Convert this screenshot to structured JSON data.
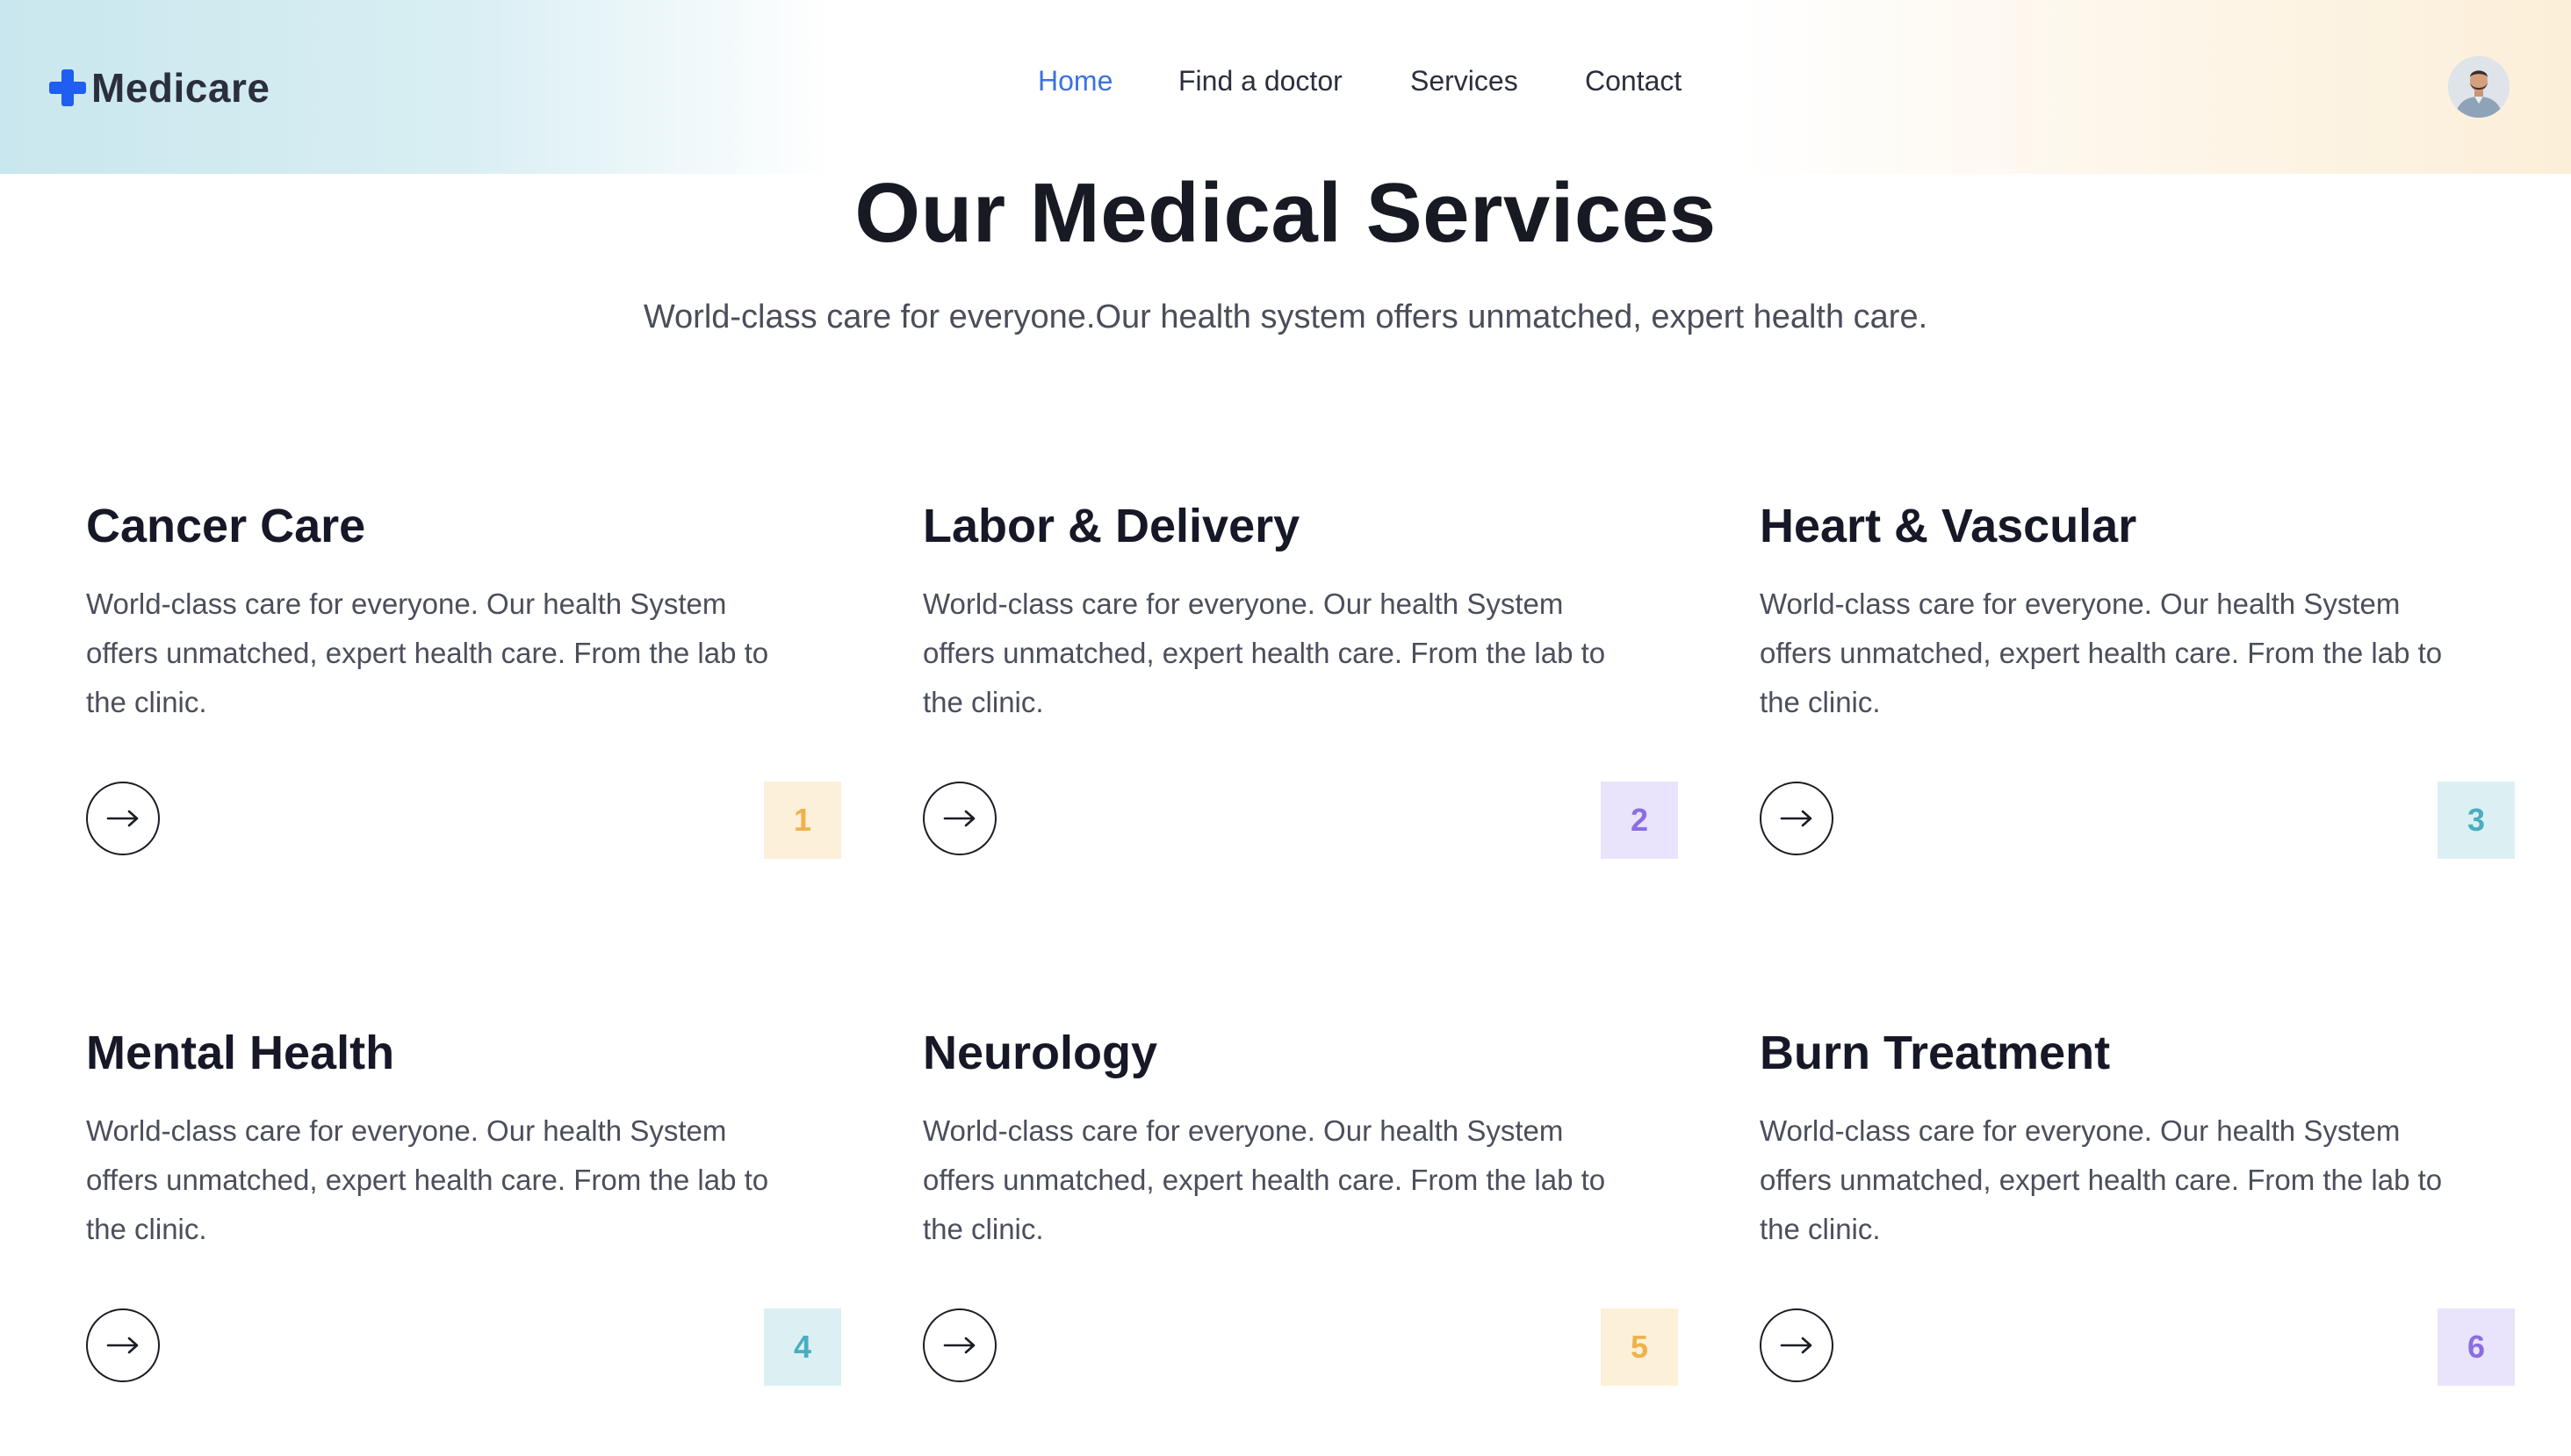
{
  "header": {
    "logo_text": "Medicare",
    "nav": [
      {
        "label": "Home",
        "active": true
      },
      {
        "label": "Find a doctor",
        "active": false
      },
      {
        "label": "Services",
        "active": false
      },
      {
        "label": "Contact",
        "active": false
      }
    ]
  },
  "hero": {
    "title": "Our Medical Services",
    "subtitle": "World-class care for everyone.Our health system offers unmatched, expert health care."
  },
  "services": [
    {
      "title": "Cancer Care",
      "description": "World-class care for everyone. Our health System offers unmatched, expert health care. From the lab to the clinic.",
      "number": "1",
      "badge_bg": "#fdf0d8",
      "badge_color": "#efb24a",
      "icon": "arrow-right-icon"
    },
    {
      "title": "Labor & Delivery",
      "description": "World-class care for everyone. Our health System offers unmatched, expert health care. From the lab to the clinic.",
      "number": "2",
      "badge_bg": "#e9e3fb",
      "badge_color": "#8a6ee0",
      "icon": "arrow-right-icon"
    },
    {
      "title": "Heart & Vascular",
      "description": "World-class care for everyone. Our health System offers unmatched, expert health care. From the lab to the clinic.",
      "number": "3",
      "badge_bg": "#dcf0f3",
      "badge_color": "#4aaebe",
      "icon": "arrow-right-icon"
    },
    {
      "title": "Mental Health",
      "description": "World-class care for everyone. Our health System offers unmatched, expert health care. From the lab to the clinic.",
      "number": "4",
      "badge_bg": "#dcf0f3",
      "badge_color": "#4aaebe",
      "icon": "arrow-right-icon"
    },
    {
      "title": "Neurology",
      "description": "World-class care for everyone. Our health System offers unmatched, expert health care. From the lab to the clinic.",
      "number": "5",
      "badge_bg": "#fdf0d8",
      "badge_color": "#efb24a",
      "icon": "arrow-right-icon"
    },
    {
      "title": "Burn Treatment",
      "description": "World-class care for everyone. Our health System offers unmatched, expert health care. From the lab to the clinic.",
      "number": "6",
      "badge_bg": "#e9e3fb",
      "badge_color": "#8a6ee0",
      "icon": "arrow-right-icon"
    }
  ],
  "colors": {
    "brand_blue": "#1f5ef0",
    "nav_active": "#3a73e0"
  }
}
